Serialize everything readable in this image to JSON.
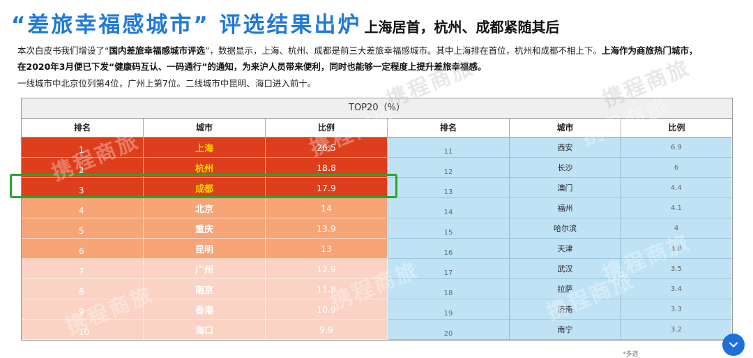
{
  "headline": {
    "main": "“差旅幸福感城市” 评选结果出炉",
    "sub": "上海居首，杭州、成都紧随其后"
  },
  "paragraph": {
    "line1_a": "本次白皮书我们增设了“",
    "line1_b": "国内差旅幸福感城市评选",
    "line1_c": "”，数据显示，上海、杭州、成都是前三大差旅幸福感城市。其中上海排在首位，杭州和成都不相上下。",
    "line1_d": "上海作为商旅热门城市，",
    "line2": "在2020年3月便已下发“健康码互认、一码通行”的通知，为来沪人员带来便利，同时也能够一定程度上提升差旅幸福感。",
    "line3": "一线城市中北京位列第4位，广州上第7位。二线城市中昆明、海口进入前十。"
  },
  "table": {
    "title": "TOP20（%）",
    "headers": [
      "排名",
      "城市",
      "比例",
      "排名",
      "城市",
      "比例"
    ],
    "left": [
      {
        "rank": "1",
        "city": "上海",
        "value": "26.5",
        "tier": 1
      },
      {
        "rank": "2",
        "city": "杭州",
        "value": "18.8",
        "tier": 1
      },
      {
        "rank": "3",
        "city": "成都",
        "value": "17.9",
        "tier": 1
      },
      {
        "rank": "4",
        "city": "北京",
        "value": "14",
        "tier": 2
      },
      {
        "rank": "5",
        "city": "重庆",
        "value": "13.9",
        "tier": 2
      },
      {
        "rank": "6",
        "city": "昆明",
        "value": "13",
        "tier": 2
      },
      {
        "rank": "7",
        "city": "广州",
        "value": "12.9",
        "tier": 3
      },
      {
        "rank": "8",
        "city": "南京",
        "value": "11.8",
        "tier": 3
      },
      {
        "rank": "9",
        "city": "香港",
        "value": "10.9",
        "tier": 3
      },
      {
        "rank": "10",
        "city": "海口",
        "value": "9.9",
        "tier": 3
      }
    ],
    "right": [
      {
        "rank": "11",
        "city": "西安",
        "value": "6.9"
      },
      {
        "rank": "12",
        "city": "长沙",
        "value": "6"
      },
      {
        "rank": "13",
        "city": "澳门",
        "value": "4.4"
      },
      {
        "rank": "14",
        "city": "福州",
        "value": "4.1"
      },
      {
        "rank": "15",
        "city": "哈尔滨",
        "value": "4"
      },
      {
        "rank": "16",
        "city": "天津",
        "value": "3.8"
      },
      {
        "rank": "17",
        "city": "武汉",
        "value": "3.5"
      },
      {
        "rank": "18",
        "city": "拉萨",
        "value": "3.4"
      },
      {
        "rank": "19",
        "city": "济南",
        "value": "3.3"
      },
      {
        "rank": "20",
        "city": "南宁",
        "value": "3.2"
      }
    ],
    "tier_colors": {
      "1": "#dd3f1c",
      "2": "#f7a477",
      "3": "#fbd3c4"
    },
    "right_color": "#bfe3f5",
    "highlight_color": "#2aa52e"
  },
  "watermark": "携程商旅",
  "footnote": "*多选",
  "scroll_button": {
    "icon": "chevron-down-icon"
  }
}
